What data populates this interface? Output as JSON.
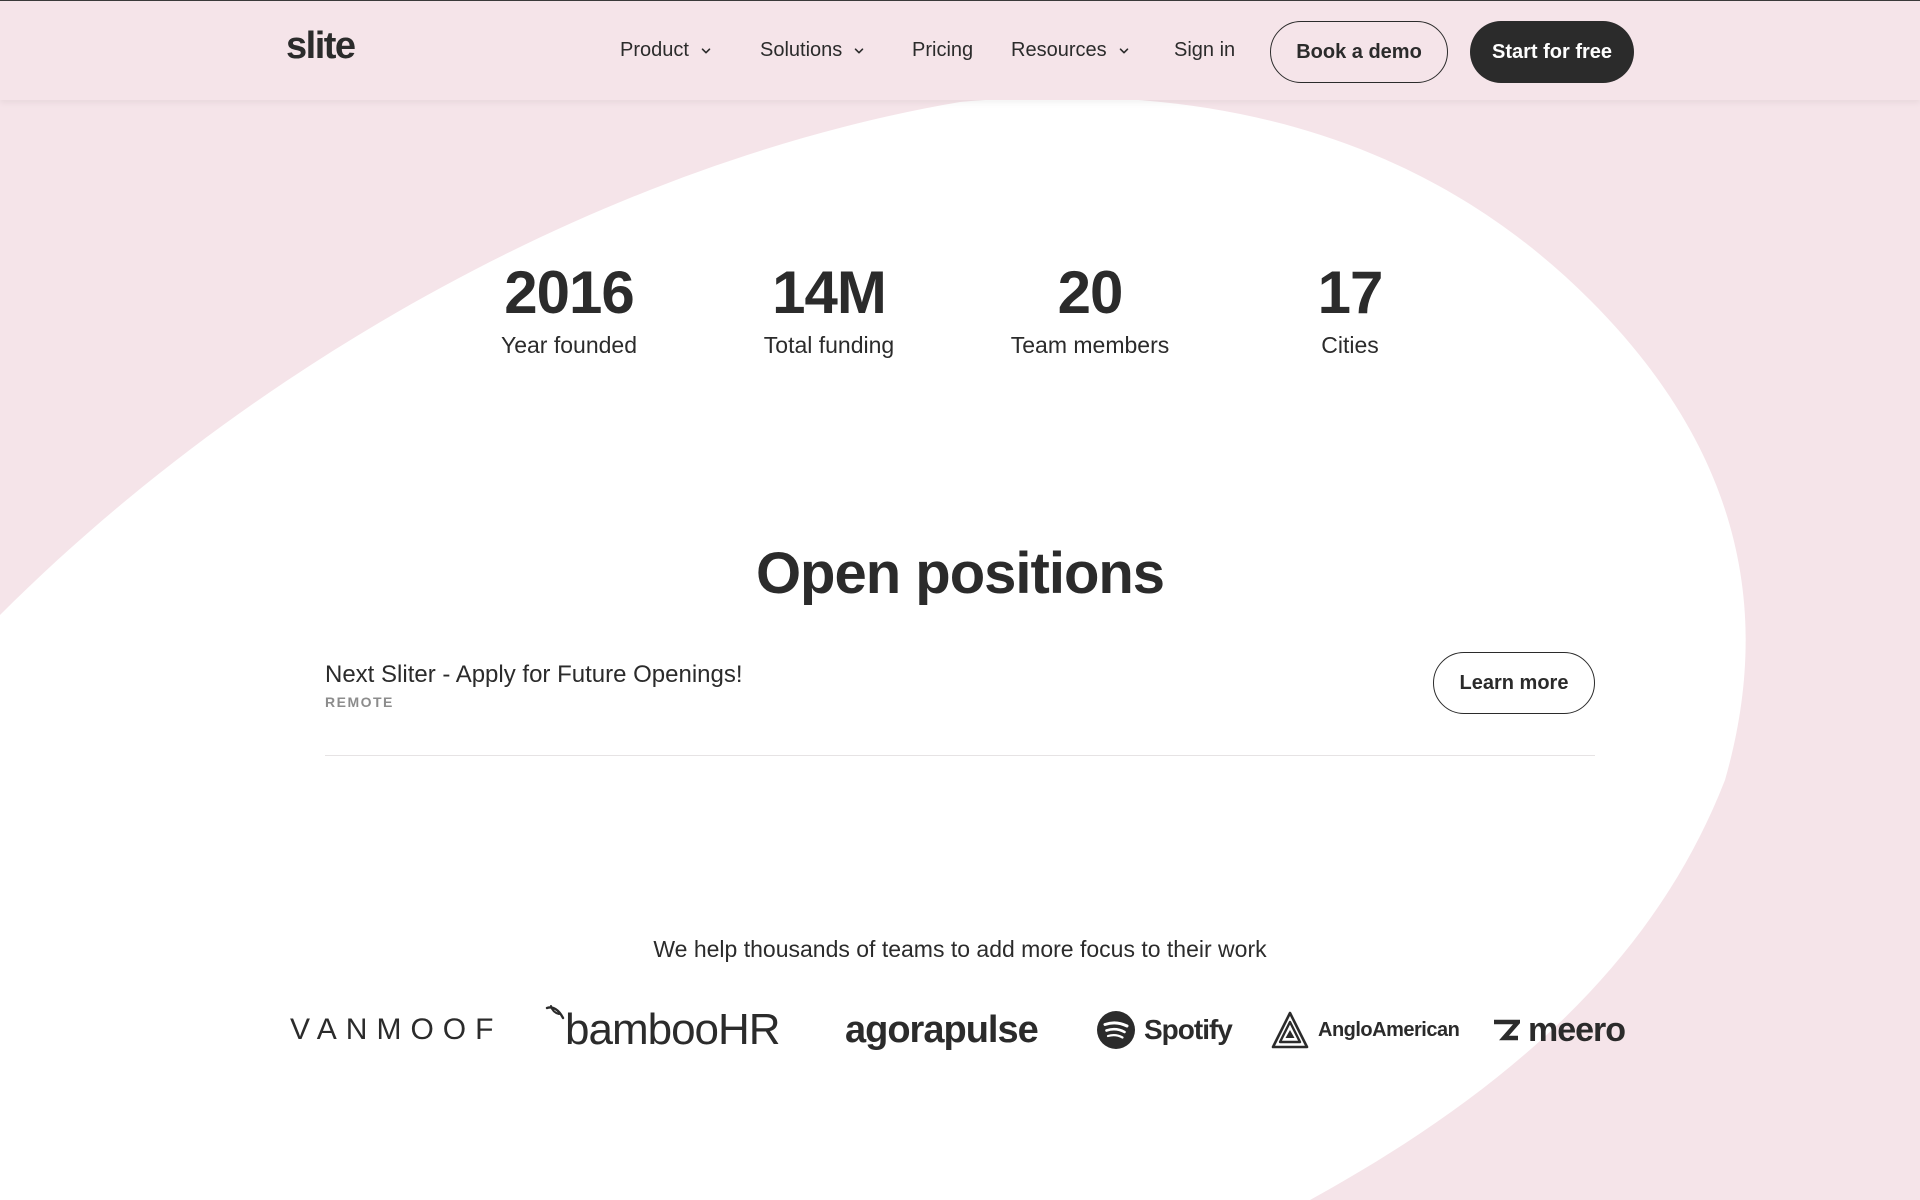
{
  "colors": {
    "background_pink": "#f5e4e9",
    "blob_white": "#ffffff",
    "text_dark": "#2b2b2b",
    "muted_text": "#8c8c8c",
    "divider": "#e6e3e4"
  },
  "header": {
    "logo": "slite",
    "nav": [
      {
        "label": "Product",
        "has_dropdown": true,
        "icon": "chevron-down-icon"
      },
      {
        "label": "Solutions",
        "has_dropdown": true,
        "icon": "chevron-down-icon"
      },
      {
        "label": "Pricing",
        "has_dropdown": false
      },
      {
        "label": "Resources",
        "has_dropdown": true,
        "icon": "chevron-down-icon"
      },
      {
        "label": "Sign in",
        "has_dropdown": false
      }
    ],
    "book_demo_label": "Book a demo",
    "start_free_label": "Start for free"
  },
  "stats": [
    {
      "value": "2016",
      "label": "Year founded"
    },
    {
      "value": "14M",
      "label": "Total funding"
    },
    {
      "value": "20",
      "label": "Team members"
    },
    {
      "value": "17",
      "label": "Cities"
    }
  ],
  "positions": {
    "title": "Open positions",
    "jobs": [
      {
        "title": "Next Sliter - Apply for Future Openings!",
        "location": "REMOTE",
        "button_label": "Learn more"
      }
    ]
  },
  "customers": {
    "tagline": "We help thousands of teams to add more focus to their work",
    "logos": [
      {
        "name": "VANMOOF",
        "icon": "vanmoof-logo"
      },
      {
        "name": "bambooHR",
        "icon": "bamboohr-logo"
      },
      {
        "name": "agorapulse",
        "icon": "agorapulse-logo"
      },
      {
        "name": "Spotify",
        "icon": "spotify-icon"
      },
      {
        "name": "AngloAmerican",
        "icon": "angloamerican-icon"
      },
      {
        "name": "meero",
        "icon": "meero-icon"
      }
    ]
  }
}
